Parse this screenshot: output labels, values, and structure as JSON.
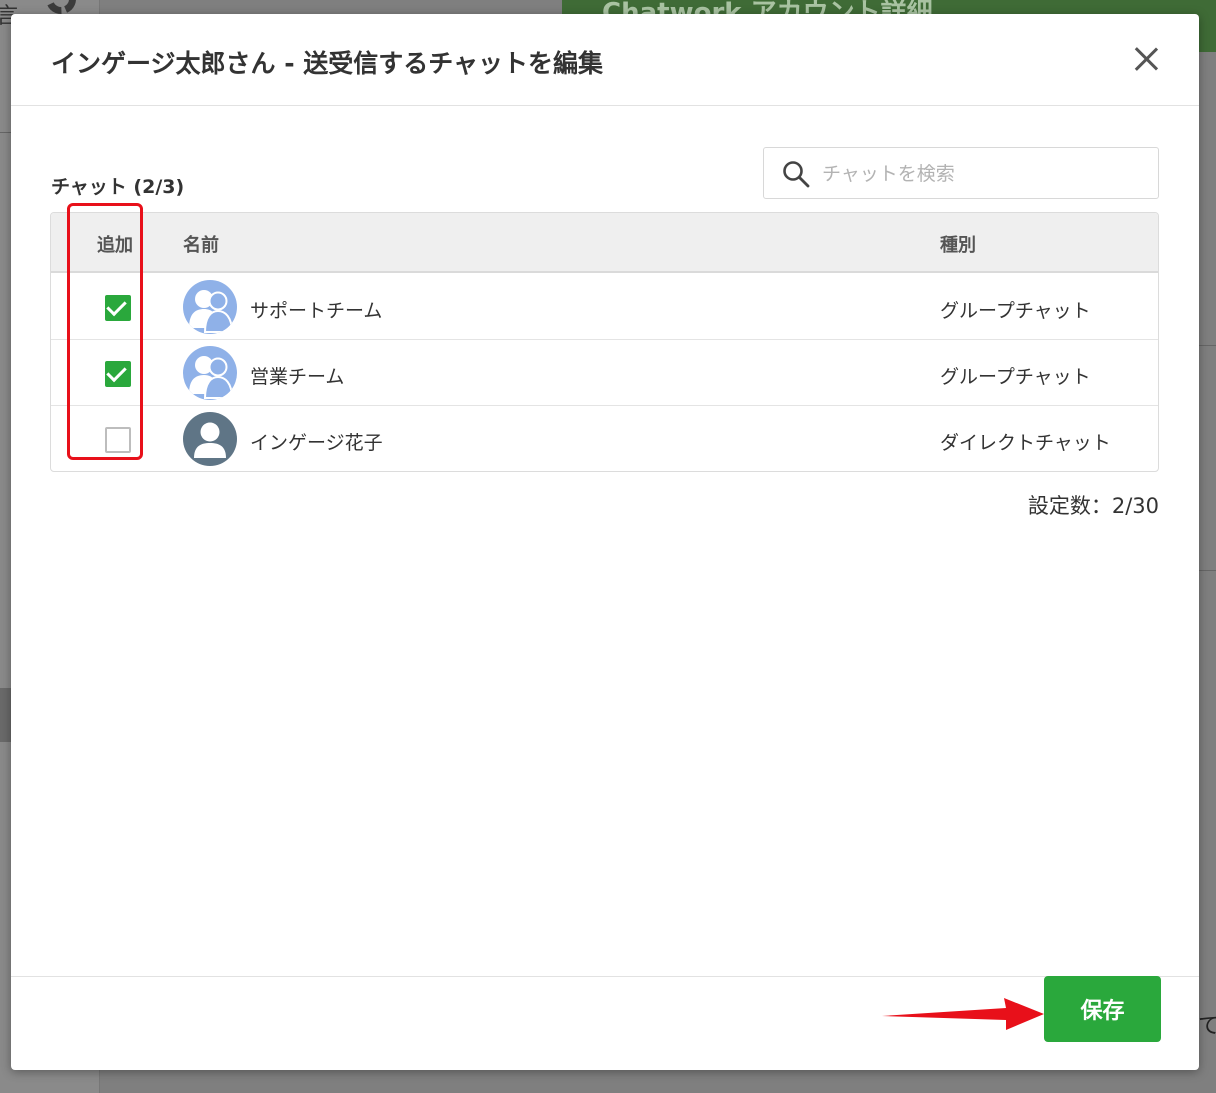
{
  "background": {
    "header_text": "Chatwork アカウント詳細",
    "left_char": "言",
    "right_char": "て"
  },
  "modal": {
    "title": "インゲージ太郎さん - 送受信するチャットを編集",
    "section_label": "チャット (2/3)",
    "search": {
      "placeholder": "チャットを検索",
      "value": ""
    },
    "table": {
      "headers": {
        "add": "追加",
        "name": "名前",
        "type": "種別"
      },
      "rows": [
        {
          "checked": true,
          "name": "サポートチーム",
          "type": "グループチャット",
          "avatar": "group-avatar-icon"
        },
        {
          "checked": true,
          "name": "営業チーム",
          "type": "グループチャット",
          "avatar": "group-avatar-icon"
        },
        {
          "checked": false,
          "name": "インゲージ花子",
          "type": "ダイレクトチャット",
          "avatar": "user-avatar-icon"
        }
      ]
    },
    "count_text": "設定数：2/30",
    "save_label": "保存"
  },
  "colors": {
    "accent_green": "#2aa83c",
    "highlight_red": "#e8101a",
    "group_avatar": "#8fb1e8",
    "direct_avatar": "#5f7586"
  }
}
